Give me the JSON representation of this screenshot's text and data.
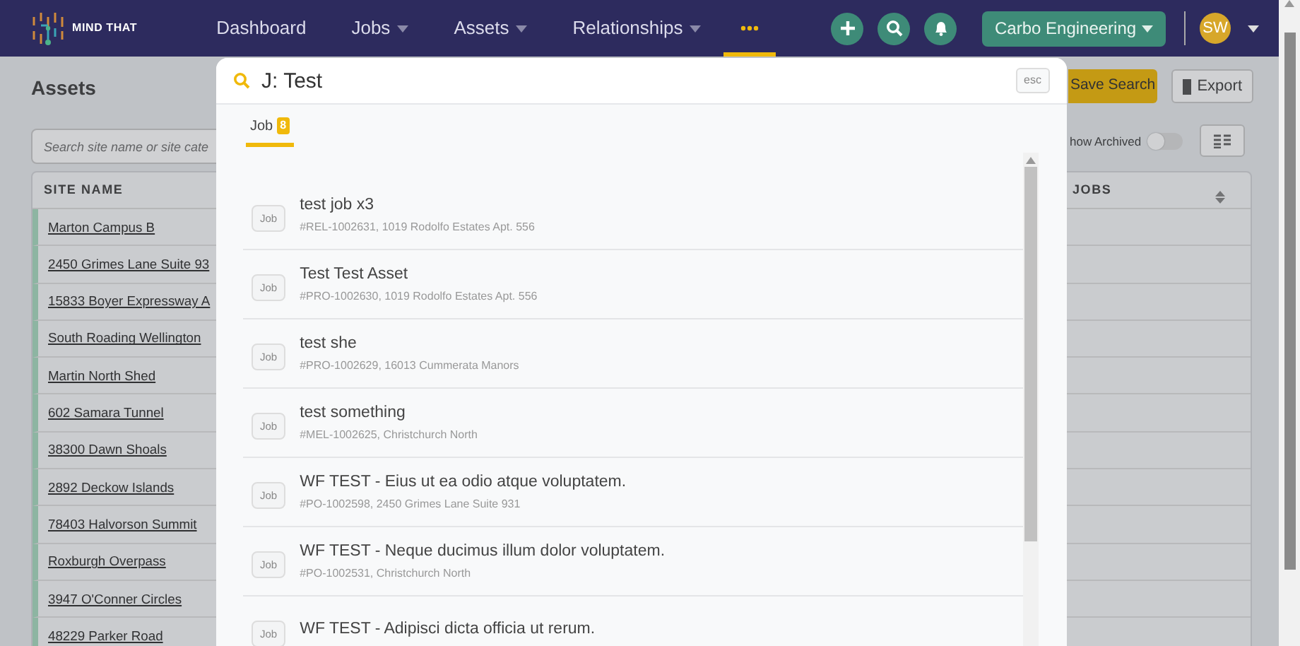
{
  "navbar": {
    "brand": "MIND THAT",
    "items": [
      {
        "label": "Dashboard",
        "dropdown": false,
        "selected": false
      },
      {
        "label": "Jobs",
        "dropdown": true,
        "selected": false
      },
      {
        "label": "Assets",
        "dropdown": true,
        "selected": false
      },
      {
        "label": "Relationships",
        "dropdown": true,
        "selected": false
      }
    ],
    "more_menu": {
      "selected": true
    },
    "company": "Carbo Engineering",
    "avatar": "SW"
  },
  "page": {
    "title": "Assets",
    "search": {
      "placeholder": "Search site name or site cate"
    },
    "buttons": [
      "Save Search",
      "Export"
    ],
    "show_archived": {
      "label": "how Archived",
      "on": false
    },
    "table": {
      "columns": [
        "SITE NAME",
        "JOBS"
      ],
      "rows": [
        "Marton Campus B",
        "2450 Grimes Lane Suite 93",
        "15833 Boyer Expressway A",
        "South Roading Wellington",
        "Martin North Shed",
        "602 Samara Tunnel",
        "38300 Dawn Shoals",
        "2892 Deckow Islands",
        "78403 Halvorson Summit",
        "Roxburgh Overpass",
        "3947 O'Conner Circles",
        "48229 Parker Road"
      ]
    }
  },
  "search_modal": {
    "query": "J: Test",
    "esc": "esc",
    "tabs": [
      {
        "label": "Job",
        "count": "8",
        "selected": true
      }
    ],
    "results": [
      {
        "badge": "Job",
        "title": "test job x3",
        "subtitle": "#REL-1002631, 1019 Rodolfo Estates Apt. 556"
      },
      {
        "badge": "Job",
        "title": "Test Test Asset",
        "subtitle": "#PRO-1002630, 1019 Rodolfo Estates Apt. 556"
      },
      {
        "badge": "Job",
        "title": "test she",
        "subtitle": "#PRO-1002629, 16013 Cummerata Manors"
      },
      {
        "badge": "Job",
        "title": "test something",
        "subtitle": "#MEL-1002625, Christchurch North"
      },
      {
        "badge": "Job",
        "title": "WF TEST - Eius ut ea odio atque voluptatem.",
        "subtitle": "#PO-1002598, 2450 Grimes Lane Suite 931"
      },
      {
        "badge": "Job",
        "title": "WF TEST - Neque ducimus illum dolor voluptatem.",
        "subtitle": "#PO-1002531, Christchurch North"
      },
      {
        "badge": "Job",
        "title": "WF TEST - Adipisci dicta officia ut rerum."
      }
    ]
  }
}
